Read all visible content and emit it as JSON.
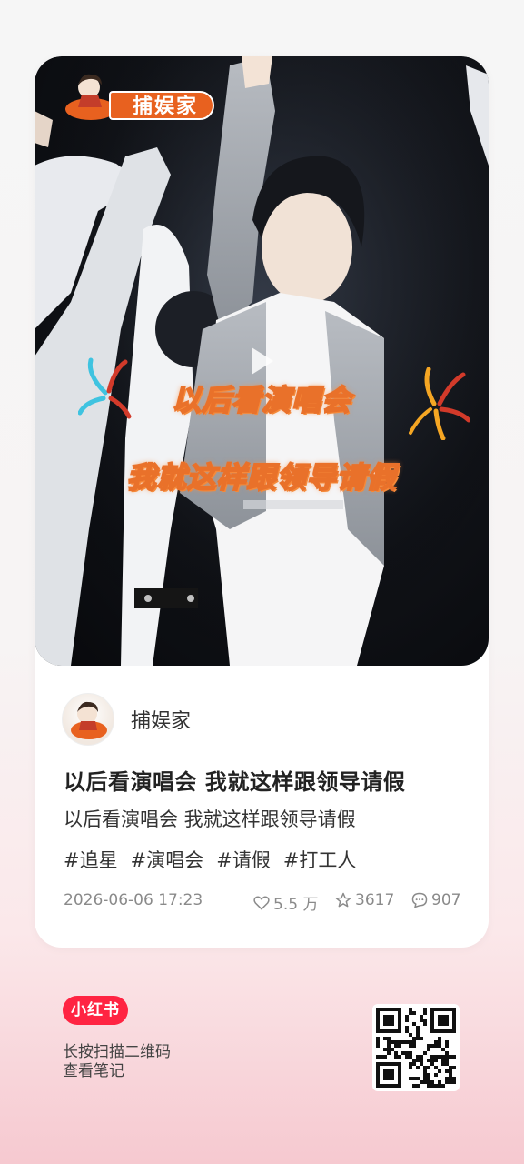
{
  "note": {
    "badge_label": "捕娱家",
    "caption_line1": "以后看演唱会",
    "caption_line2": "我就这样跟领导请假",
    "author": "捕娱家",
    "title": "以后看演唱会 我就这样跟领导请假",
    "description": "以后看演唱会 我就这样跟领导请假",
    "tags": [
      "#追星",
      "#演唱会",
      "#请假",
      "#打工人"
    ],
    "date": "2026-06-06 17:23",
    "likes": "5.5 万",
    "collects": "3617",
    "comments": "907"
  },
  "footer": {
    "logo": "小红书",
    "hint_line1": "长按扫描二维码",
    "hint_line2": "查看笔记"
  },
  "icons": {
    "play": "play-icon",
    "like": "heart-icon",
    "collect": "star-icon",
    "comment": "comment-icon"
  },
  "colors": {
    "brand": "#ff2442",
    "badge_orange": "#e8611f",
    "caption_outline": "#e9712a"
  }
}
